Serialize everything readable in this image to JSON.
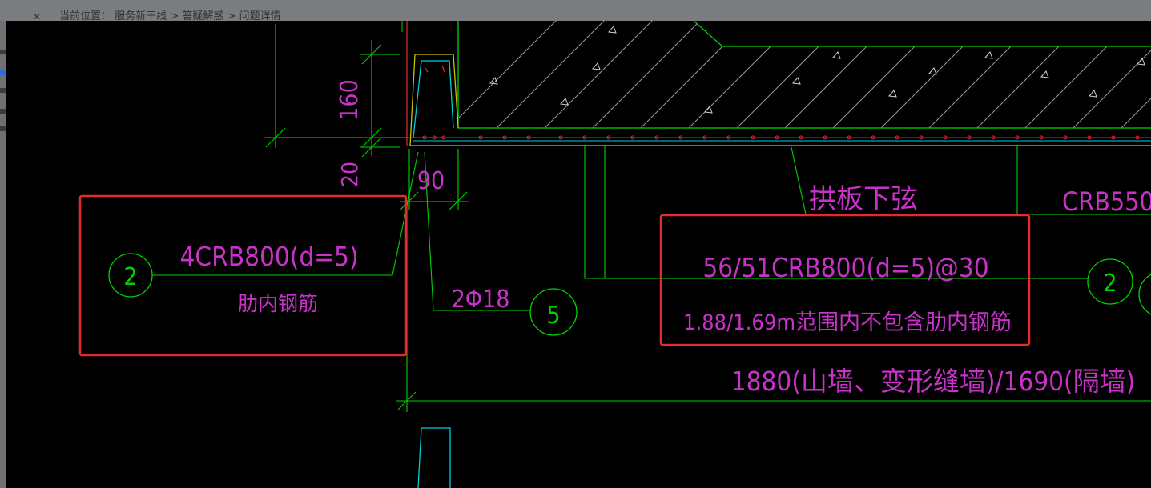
{
  "breadcrumb": {
    "label": "当前位置：",
    "items": [
      "服务新干线",
      "答疑解惑",
      "问题详情"
    ],
    "separator": ">"
  },
  "drawing": {
    "colors": {
      "background": "#000000",
      "green": "#00d400",
      "magenta": "#c832c8",
      "red": "#e32b2b",
      "cyan": "#00cfd8",
      "yellow": "#c7c400",
      "hatch": "#cfcfcf"
    },
    "dimensions": {
      "d160": "160",
      "d20": "20",
      "d90": "90",
      "span": "1880(山墙、变形缝墙)/1690(隔墙)"
    },
    "labels": {
      "arch_bottom": "拱板下弦",
      "crb550": "CRB550",
      "left_rebar": "4CRB800(d=5)",
      "left_rebar_note": "肋内钢筋",
      "main_rebar": "2Φ18",
      "right_rebar": "56/51CRB800(d=5)@30",
      "right_rebar_note": "1.88/1.69m范围内不包含肋内钢筋"
    },
    "callouts": {
      "left": "2",
      "middle": "5",
      "right": "2"
    }
  }
}
